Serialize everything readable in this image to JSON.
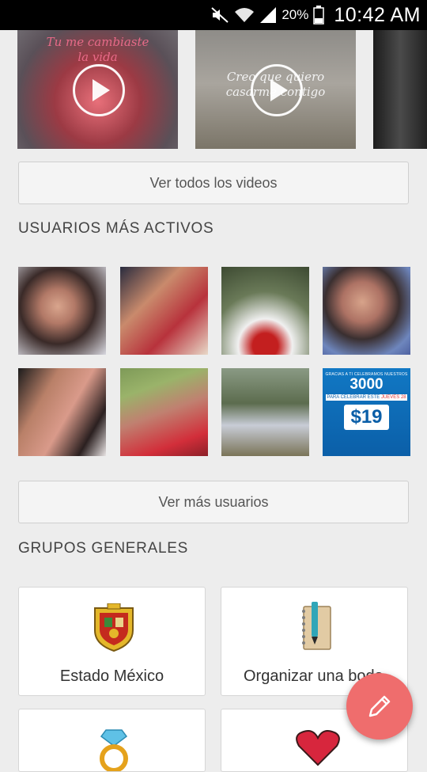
{
  "statusbar": {
    "battery": "20%",
    "time": "10:42 AM"
  },
  "videos": [
    {
      "caption_line1": "Tu me cambiaste",
      "caption_line2": "la vida"
    },
    {
      "caption_line1": "Creo que quiero",
      "caption_line2": "casarme contigo"
    },
    {
      "caption_line1": "",
      "caption_line2": ""
    }
  ],
  "videos_button": "Ver todos los videos",
  "active_users": {
    "title": "USUARIOS MÁS ACTIVOS",
    "promo": {
      "line1": "GRACIAS A TI CELEBRAMOS NUESTROS",
      "number": "3000",
      "line2": "PARA CELEBRAR ESTE",
      "day": "JUEVES 28",
      "price": "$19"
    },
    "more_button": "Ver más usuarios"
  },
  "groups": {
    "title": "GRUPOS GENERALES",
    "items": [
      {
        "label": "Estado México",
        "icon": "coat-of-arms-icon"
      },
      {
        "label": "Organizar una boda",
        "icon": "notebook-pen-icon"
      },
      {
        "label": "",
        "icon": "diamond-ring-icon"
      },
      {
        "label": "",
        "icon": "heart-icon"
      }
    ]
  },
  "fab": {
    "icon": "pencil-icon"
  }
}
